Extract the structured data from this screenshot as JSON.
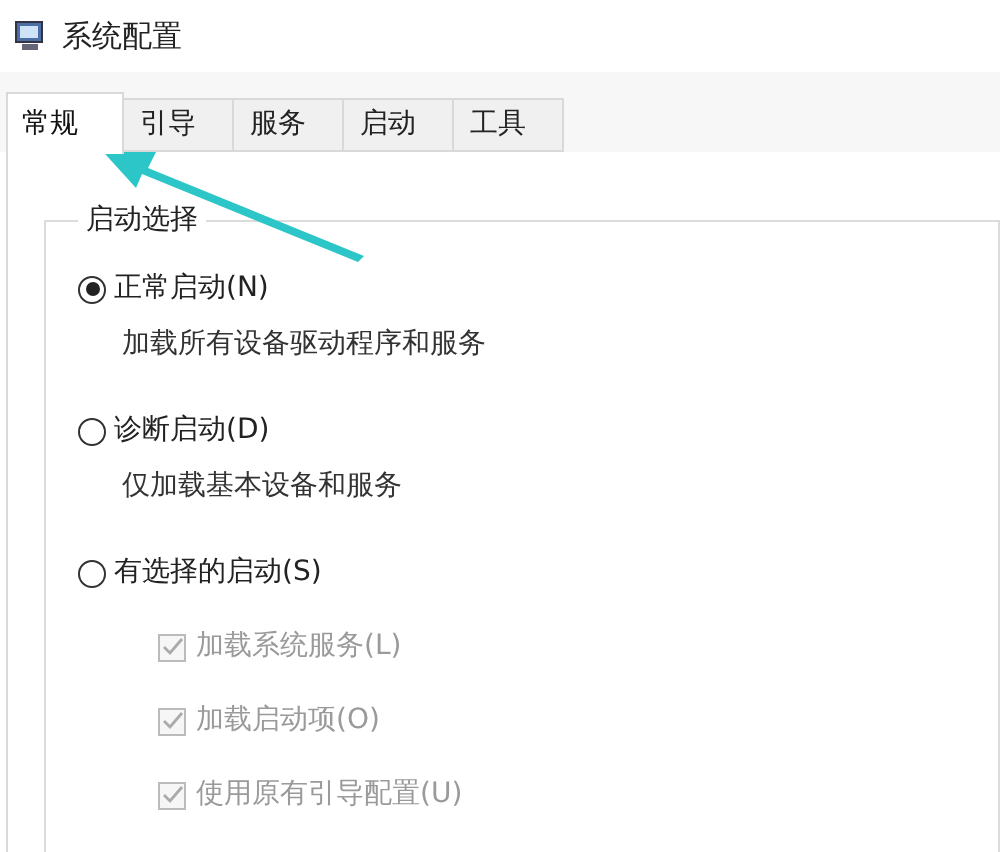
{
  "window": {
    "title": "系统配置"
  },
  "tabs": [
    {
      "label": "常规",
      "selected": true
    },
    {
      "label": "引导",
      "selected": false
    },
    {
      "label": "服务",
      "selected": false
    },
    {
      "label": "启动",
      "selected": false
    },
    {
      "label": "工具",
      "selected": false
    }
  ],
  "startup_group": {
    "title": "启动选择",
    "options": [
      {
        "label": "正常启动(N)",
        "selected": true,
        "description": "加载所有设备驱动程序和服务"
      },
      {
        "label": "诊断启动(D)",
        "selected": false,
        "description": "仅加载基本设备和服务"
      },
      {
        "label": "有选择的启动(S)",
        "selected": false,
        "checkboxes": [
          {
            "label": "加载系统服务(L)",
            "checked": true,
            "disabled": true
          },
          {
            "label": "加载启动项(O)",
            "checked": true,
            "disabled": true
          },
          {
            "label": "使用原有引导配置(U)",
            "checked": true,
            "disabled": true
          }
        ]
      }
    ]
  }
}
